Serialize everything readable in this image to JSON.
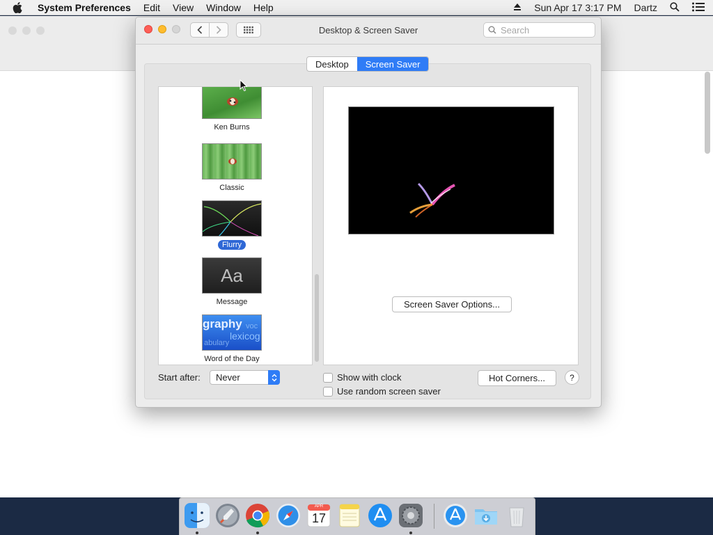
{
  "menubar": {
    "app_name": "System Preferences",
    "items": [
      "Edit",
      "View",
      "Window",
      "Help"
    ],
    "datetime": "Sun Apr 17  3:17 PM",
    "user": "Dartz"
  },
  "window": {
    "title": "Desktop & Screen Saver",
    "search_placeholder": "Search"
  },
  "tabs": [
    {
      "label": "Desktop",
      "active": false
    },
    {
      "label": "Screen Saver",
      "active": true
    }
  ],
  "savers": [
    {
      "label": "Ken Burns",
      "selected": false
    },
    {
      "label": "Classic",
      "selected": false
    },
    {
      "label": "Flurry",
      "selected": true
    },
    {
      "label": "Message",
      "selected": false,
      "thumb_text": "Aa"
    },
    {
      "label": "Word of the Day",
      "selected": false,
      "thumb_words": [
        "graphy",
        "lexicog",
        "abulary",
        "voc"
      ]
    }
  ],
  "options_button": "Screen Saver Options...",
  "start_after": {
    "label": "Start after:",
    "value": "Never"
  },
  "checkboxes": [
    {
      "label": "Show with clock",
      "checked": false
    },
    {
      "label": "Use random screen saver",
      "checked": false
    }
  ],
  "hot_corners_button": "Hot Corners...",
  "help_button": "?",
  "calendar": {
    "month": "APR",
    "day": "17"
  },
  "colors": {
    "accent": "#2f7cf6",
    "close": "#fe5f57",
    "minimize": "#febc2e"
  }
}
